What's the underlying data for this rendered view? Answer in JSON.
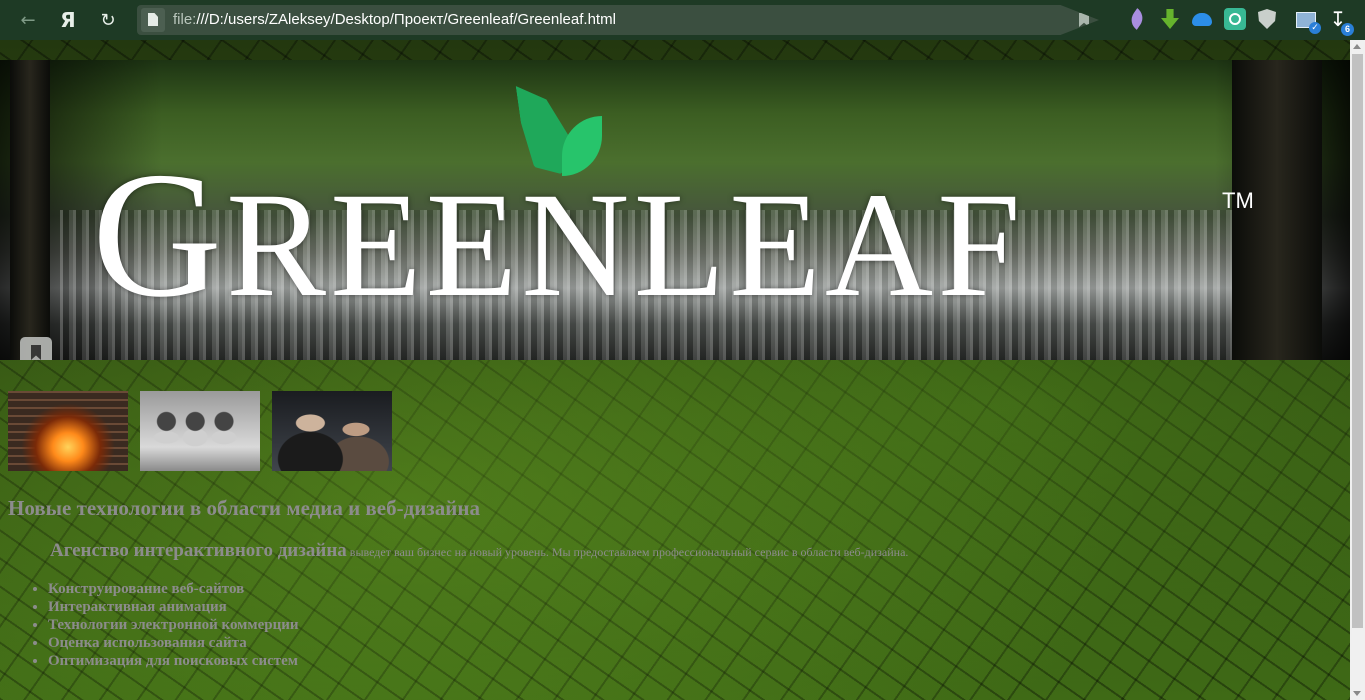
{
  "browser": {
    "yandex_glyph": "Я",
    "address_scheme": "file:",
    "address_path": "///D:/users/ZAleksey/Desktop/Проект/Greenleaf/Greenleaf.html",
    "download_count": "6",
    "icons": [
      "back-icon",
      "yandex-icon",
      "reload-icon",
      "page-icon",
      "bookmark-icon",
      "feather-extension-icon",
      "download-extension-icon",
      "cloud-extension-icon",
      "q-extension-icon",
      "shield-extension-icon",
      "photo-extension-icon",
      "downloads-icon"
    ]
  },
  "banner": {
    "brand_first": "G",
    "brand_rest": "REENLEAF",
    "trademark": "TM"
  },
  "thumbnails": [
    {
      "name": "fireplace"
    },
    {
      "name": "toys"
    },
    {
      "name": "people"
    }
  ],
  "content": {
    "headline": "Новые технологии в области медиа и веб-дизайна",
    "intro_strong": "Агенство интерактивного дизайна",
    "intro_rest": " выведет ваш бизнес на новый уровень. Мы предоставляем профессиональный сервис в области веб-дизайна.",
    "services": [
      "Конструирование веб-сайтов",
      "Интерактивная анимация",
      "Технологии электронной коммерции",
      "Оценка использования сайта",
      "Оптимизация для поисковых систем"
    ]
  },
  "colors": {
    "toolbar": "#1e3a25",
    "address_bar": "#3b4f40",
    "leaf": "#27c46b",
    "body_text": "#8c8c8c"
  }
}
